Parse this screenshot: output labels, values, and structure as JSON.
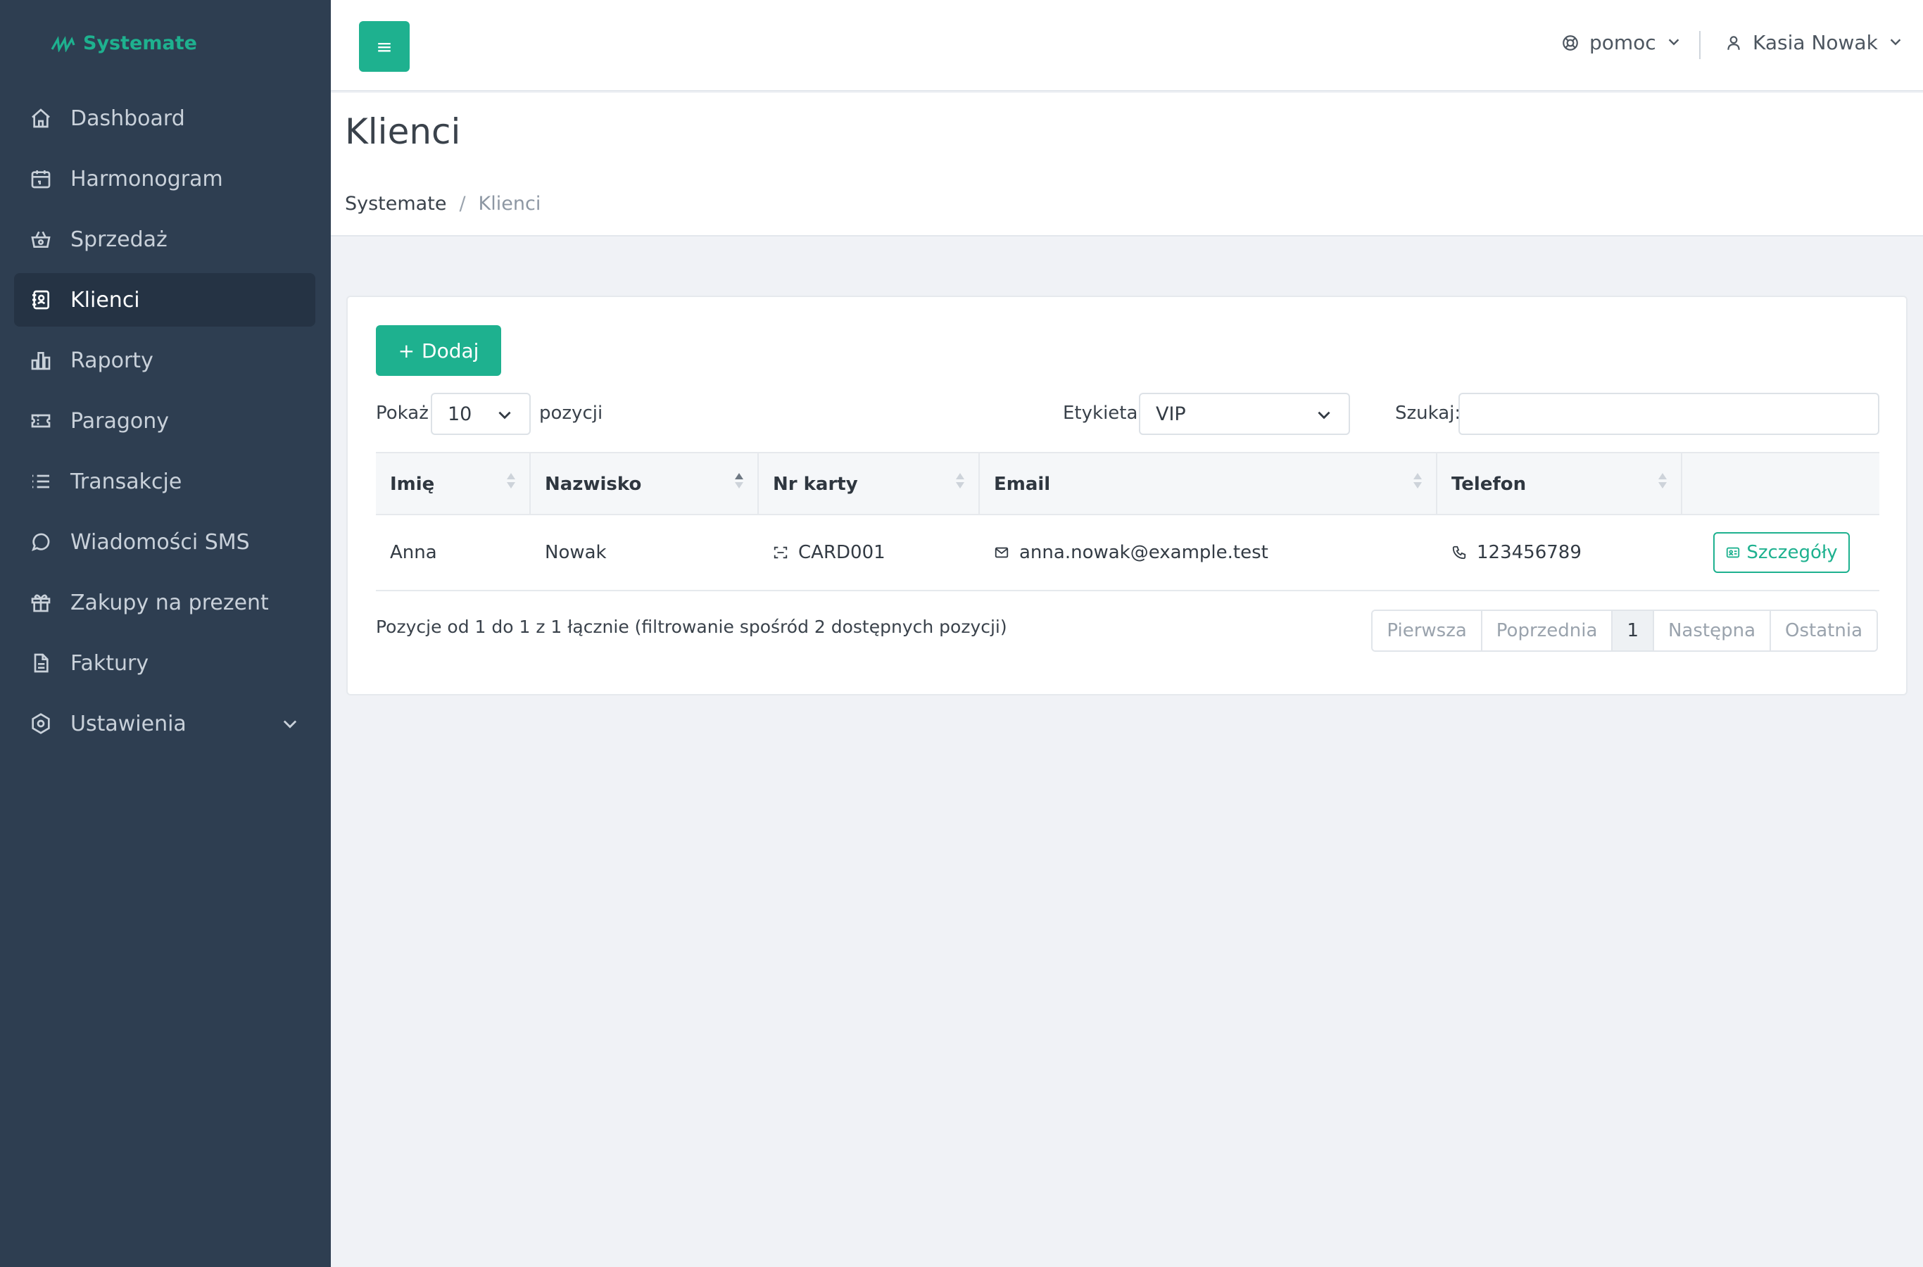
{
  "brand": {
    "name": "Systemate"
  },
  "sidebar": {
    "items": [
      {
        "label": "Dashboard",
        "icon": "home-icon"
      },
      {
        "label": "Harmonogram",
        "icon": "calendar-icon"
      },
      {
        "label": "Sprzedaż",
        "icon": "basket-icon"
      },
      {
        "label": "Klienci",
        "icon": "contacts-icon",
        "active": true
      },
      {
        "label": "Raporty",
        "icon": "bar-chart-icon"
      },
      {
        "label": "Paragony",
        "icon": "ticket-icon"
      },
      {
        "label": "Transakcje",
        "icon": "list-icon"
      },
      {
        "label": "Wiadomości SMS",
        "icon": "chat-icon"
      },
      {
        "label": "Zakupy na prezent",
        "icon": "gift-icon"
      },
      {
        "label": "Faktury",
        "icon": "document-icon"
      },
      {
        "label": "Ustawienia",
        "icon": "settings-icon",
        "expandable": true
      }
    ]
  },
  "topbar": {
    "menu_glyph": "≡",
    "help_label": "pomoc",
    "user_name": "Kasia Nowak"
  },
  "page": {
    "title": "Klienci",
    "breadcrumb": {
      "home": "Systemate",
      "separator": "/",
      "current": "Klienci"
    }
  },
  "toolbar": {
    "add_label": "Dodaj",
    "show_label": "Pokaż",
    "page_size": "10",
    "entries_label": "pozycji",
    "tag_label": "Etykieta",
    "tag_value": "VIP",
    "search_label": "Szukaj:",
    "search_value": ""
  },
  "table": {
    "columns": [
      "Imię",
      "Nazwisko",
      "Nr karty",
      "Email",
      "Telefon",
      ""
    ],
    "rows": [
      {
        "first_name": "Anna",
        "last_name": "Nowak",
        "card": "CARD001",
        "email": "anna.nowak@example.test",
        "phone": "123456789",
        "action": "Szczegóły"
      }
    ]
  },
  "footer": {
    "info": "Pozycje od 1 do 1 z 1 łącznie (filtrowanie spośród 2 dostępnych pozycji)",
    "pager": {
      "first": "Pierwsza",
      "prev": "Poprzednia",
      "current": "1",
      "next": "Następna",
      "last": "Ostatnia"
    }
  },
  "colors": {
    "accent": "#1eb18f",
    "sidebar": "#2e3e51",
    "sidebar_active": "#253344"
  }
}
